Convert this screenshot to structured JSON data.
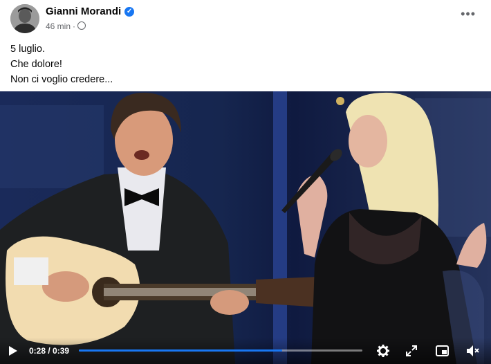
{
  "post": {
    "author": "Gianni Morandi",
    "time": "46 min",
    "separator": "·",
    "text_lines": [
      "5 luglio.",
      "Che dolore!",
      "Non ci voglio credere..."
    ]
  },
  "video": {
    "current_time": "0:28",
    "duration": "0:39",
    "time_label": "0:28 / 0:39",
    "progress": 0.718
  },
  "icons": {
    "verified": "verified-badge-icon",
    "privacy": "globe-icon",
    "more": "more-options-icon",
    "play": "play-icon",
    "settings": "gear-icon",
    "fullscreen": "expand-icon",
    "pip": "picture-in-picture-icon",
    "volume": "volume-icon"
  },
  "colors": {
    "accent": "#1877f2",
    "meta": "#65676b"
  }
}
